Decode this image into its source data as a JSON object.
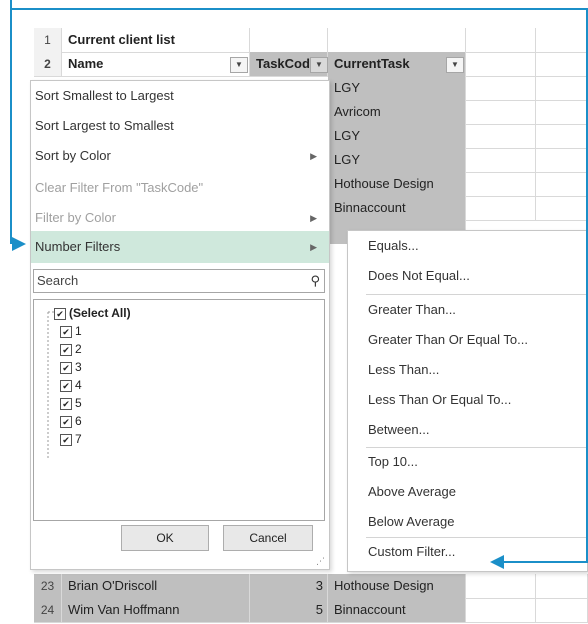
{
  "sheet": {
    "rows": [
      {
        "num": "1",
        "a": "Current client list",
        "b": "",
        "c": ""
      },
      {
        "num": "2",
        "a": "Name",
        "b": "TaskCod",
        "c": "CurrentTask"
      },
      {
        "num": "",
        "a": "",
        "b": "",
        "c": "LGY"
      },
      {
        "num": "",
        "a": "",
        "b": "",
        "c": "Avricom"
      },
      {
        "num": "",
        "a": "",
        "b": "",
        "c": "LGY"
      },
      {
        "num": "",
        "a": "",
        "b": "",
        "c": "LGY"
      },
      {
        "num": "",
        "a": "",
        "b": "",
        "c": "Hothouse Design"
      },
      {
        "num": "",
        "a": "",
        "b": "",
        "c": "Binnaccount"
      }
    ],
    "bottom_rows": [
      {
        "num": "23",
        "a": "Brian O'Driscoll",
        "b": "3",
        "c": "Hothouse Design"
      },
      {
        "num": "24",
        "a": "Wim Van Hoffmann",
        "b": "5",
        "c": "Binnaccount"
      }
    ]
  },
  "menu": {
    "sort_asc": "Sort Smallest to Largest",
    "sort_desc": "Sort Largest to Smallest",
    "sort_color": "Sort by Color",
    "clear_filter": "Clear Filter From \"TaskCode\"",
    "filter_color": "Filter by Color",
    "number_filters": "Number Filters",
    "search_placeholder": "Search",
    "tree_items": [
      "(Select All)",
      "1",
      "2",
      "3",
      "4",
      "5",
      "6",
      "7"
    ],
    "ok_label": "OK",
    "cancel_label": "Cancel"
  },
  "submenu": {
    "items": [
      "Equals...",
      "Does Not Equal...",
      "Greater Than...",
      "Greater Than Or Equal To...",
      "Less Than...",
      "Less Than Or Equal To...",
      "Between...",
      "Top 10...",
      "Above Average",
      "Below Average",
      "Custom Filter..."
    ]
  },
  "colors": {
    "accent": "#1b8fc8",
    "highlight": "#cfe8dc",
    "selection": "#bfbfbf"
  }
}
